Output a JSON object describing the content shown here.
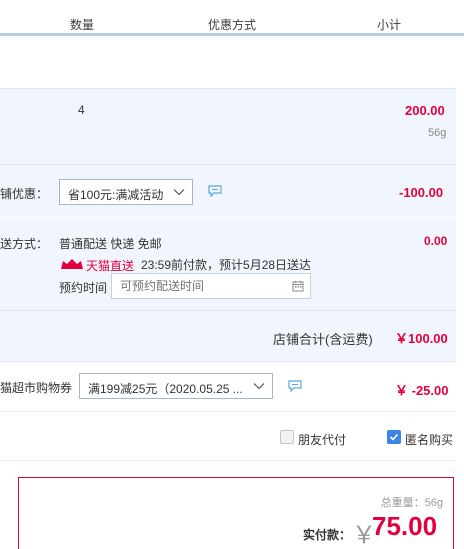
{
  "header": {
    "col_quantity": "数量",
    "col_discount": "优惠方式",
    "col_subtotal": "小计"
  },
  "item": {
    "quantity": "4",
    "subtotal": "200.00",
    "weight": "56g"
  },
  "shop_discount": {
    "label": "铺优惠：",
    "selected": "省100元:满减活动",
    "amount": "-100.00"
  },
  "delivery": {
    "label": "送方式：",
    "method": "普通配送 快递 免邮",
    "amount": "0.00",
    "tmall_badge": "天猫直送",
    "promise": "23:59前付款，预计5月28日送达",
    "appoint_label": "预约时间",
    "appoint_placeholder": "可预约配送时间"
  },
  "shop_total": {
    "label": "店铺合计(含运费)",
    "value": "￥100.00"
  },
  "coupon": {
    "label": "猫超市购物券",
    "selected": "满199减25元（2020.05.25 ...",
    "amount": "￥ -25.00"
  },
  "options": {
    "friend_pay": "朋友代付",
    "anonymous": "匿名购买",
    "friend_pay_checked": false,
    "anonymous_checked": true
  },
  "summary": {
    "total_weight": "总重量：56g",
    "pay_label": "实付款：",
    "currency": "￥",
    "pay_value": "75.00"
  },
  "colors": {
    "accent_red": "#e4003c",
    "band_blue": "#f1f5fd",
    "checkbox_blue": "#3d84e4"
  }
}
